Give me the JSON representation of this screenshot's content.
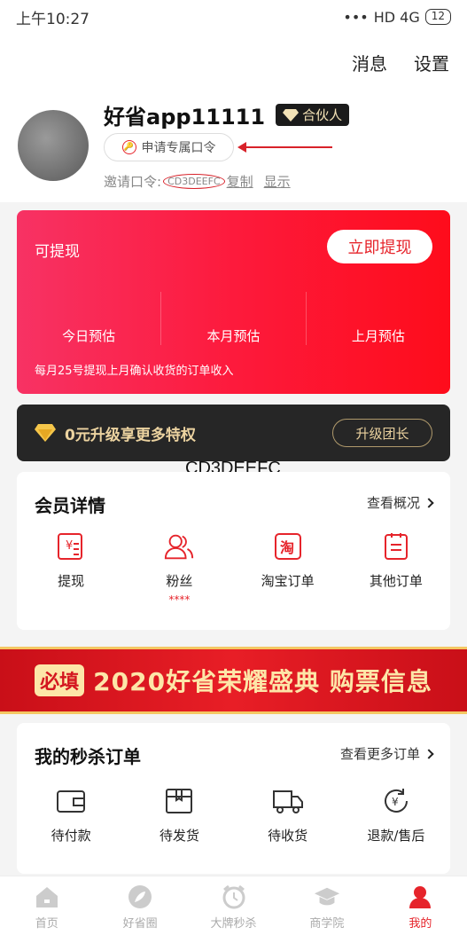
{
  "status_bar": {
    "time": "上午10:27",
    "signal_text": "HD 4G",
    "battery": "12"
  },
  "header": {
    "messages": "消息",
    "settings": "设置",
    "username": "好省app11111",
    "partner_badge": "合伙人",
    "apply_button": "申请专属口令",
    "invite_label": "邀请口令",
    "invite_code": "CD3DEEFC",
    "copy": "复制",
    "show": "显示"
  },
  "earnings": {
    "title": "可提现",
    "withdraw_button": "立即提现",
    "today": "今日预估",
    "month": "本月预估",
    "last_month": "上月预估",
    "note": "每月25号提现上月确认收货的订单收入"
  },
  "upgrade": {
    "text": "0元升级享更多特权",
    "button": "升级团长"
  },
  "overlay_code": "CD3DEEFC",
  "member": {
    "title": "会员详情",
    "more": "查看概况",
    "items": [
      {
        "label": "提现",
        "icon": "withdraw-icon"
      },
      {
        "label": "粉丝",
        "icon": "fans-icon",
        "badge": "****"
      },
      {
        "label": "淘宝订单",
        "icon": "taobao-icon"
      },
      {
        "label": "其他订单",
        "icon": "other-orders-icon"
      }
    ]
  },
  "event": {
    "tag": "必填",
    "text": "2020好省荣耀盛典 购票信息"
  },
  "orders": {
    "title": "我的秒杀订单",
    "more": "查看更多订单",
    "items": [
      {
        "label": "待付款",
        "icon": "wallet-icon"
      },
      {
        "label": "待发货",
        "icon": "box-icon"
      },
      {
        "label": "待收货",
        "icon": "truck-icon"
      },
      {
        "label": "退款/售后",
        "icon": "refund-icon"
      }
    ]
  },
  "tabs": [
    {
      "label": "首页",
      "icon": "home-icon"
    },
    {
      "label": "好省圈",
      "icon": "leaf-icon"
    },
    {
      "label": "大牌秒杀",
      "icon": "alarm-icon"
    },
    {
      "label": "商学院",
      "icon": "graduation-icon"
    },
    {
      "label": "我的",
      "icon": "profile-icon",
      "active": true
    }
  ],
  "colors": {
    "accent": "#e6242b",
    "gold": "#ecd3a0"
  }
}
